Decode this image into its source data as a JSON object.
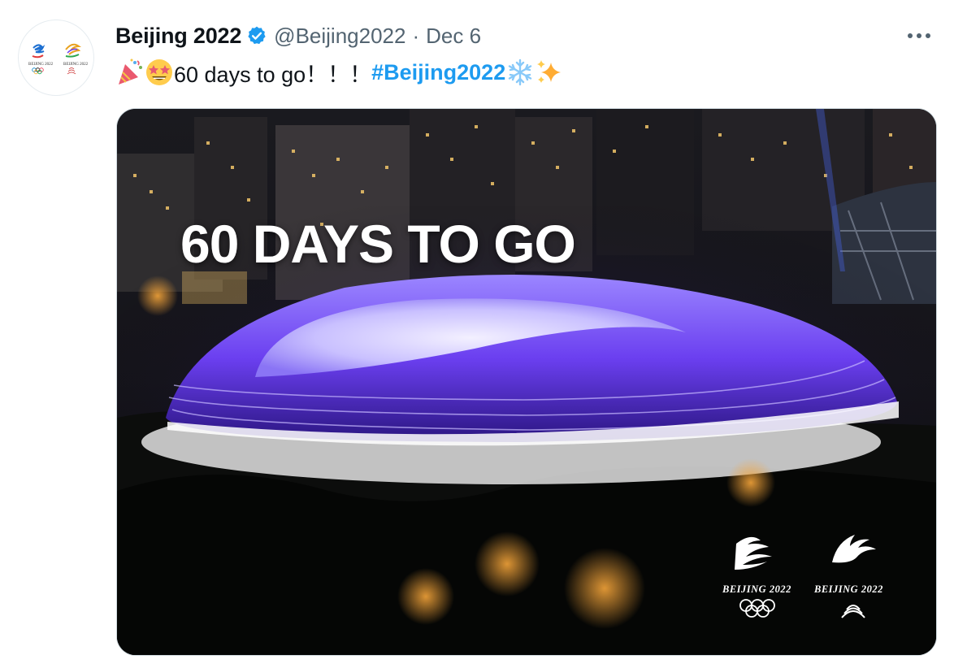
{
  "tweet": {
    "author_name": "Beijing 2022",
    "handle": "@Beijing2022",
    "separator": "·",
    "date": "Dec 6",
    "text_prefix": "60 days to go！！！",
    "hashtag": "#Beijing2022",
    "emojis": [
      "party-popper",
      "star-struck",
      "snowflake",
      "sparkles"
    ],
    "verified_color": "#1d9bf0",
    "hashtag_color": "#1d9bf0"
  },
  "media": {
    "overlay_title": "60 DAYS TO GO",
    "logo_left_caption": "BEIJING 2022",
    "logo_right_caption": "BEIJING 2022",
    "stadium_color": "#6b3ff0"
  }
}
